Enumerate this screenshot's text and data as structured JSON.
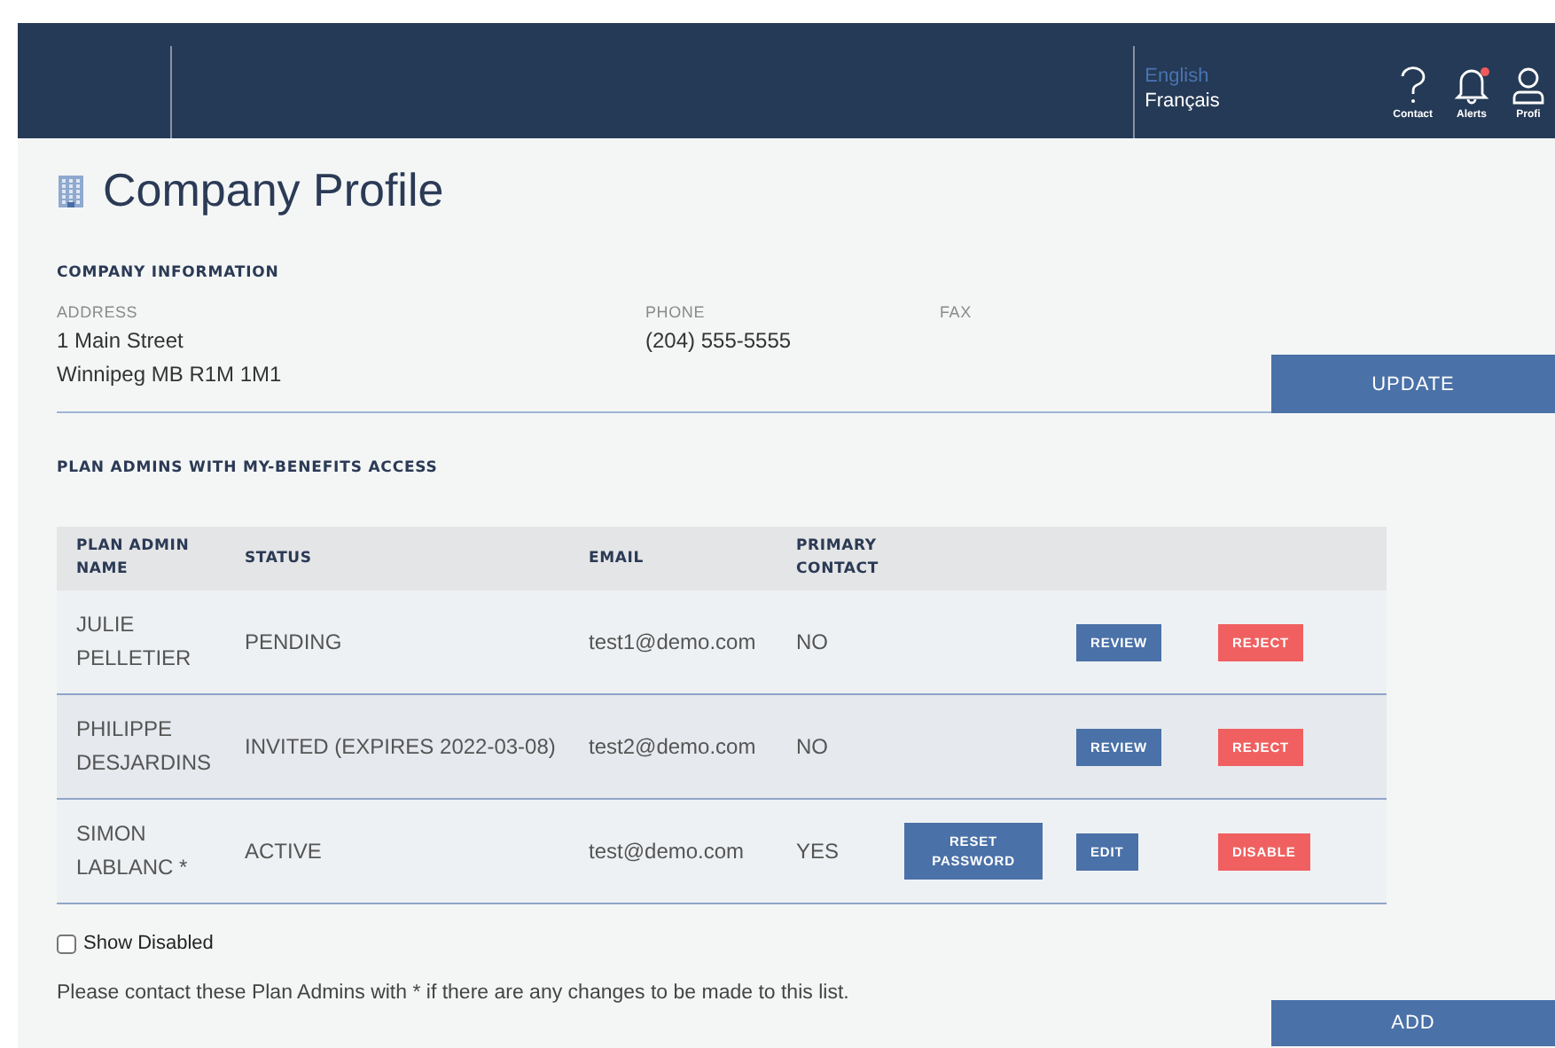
{
  "header": {
    "languages": [
      {
        "label": "English",
        "selected": true
      },
      {
        "label": "Français",
        "selected": false
      }
    ],
    "icons": [
      {
        "kind": "help",
        "label": "Contact",
        "badge": false
      },
      {
        "kind": "bell",
        "label": "Alerts",
        "badge": true
      },
      {
        "kind": "person",
        "label": "Profi",
        "badge": false
      }
    ]
  },
  "page": {
    "title": "Company Profile"
  },
  "company_information": {
    "heading": "COMPANY INFORMATION",
    "fields": [
      {
        "label": "ADDRESS",
        "lines": [
          "1 Main Street",
          "Winnipeg MB R1M 1M1"
        ]
      },
      {
        "label": "PHONE",
        "lines": [
          "(204) 555-5555"
        ]
      },
      {
        "label": "FAX"
      }
    ],
    "button": "UPDATE"
  },
  "plan_admins": {
    "heading": "PLAN ADMINS WITH MY-BENEFITS ACCESS",
    "columns": [
      "PLAN ADMIN NAME",
      "STATUS",
      "EMAIL",
      "PRIMARY CONTACT"
    ],
    "rows": [
      {
        "name": "JULIE PELLETIER",
        "status": "PENDING",
        "email": "test1@demo.com",
        "primary": "NO",
        "actions": [
          {
            "label": "REVIEW",
            "kind": "primary"
          },
          {
            "label": "REJECT",
            "kind": "danger"
          }
        ]
      },
      {
        "name": "PHILIPPE DESJARDINS",
        "status": "INVITED (EXPIRES 2022-03-08)",
        "email": "test2@demo.com",
        "primary": "NO",
        "actions": [
          {
            "label": "REVIEW",
            "kind": "primary"
          },
          {
            "label": "REJECT",
            "kind": "danger"
          }
        ]
      },
      {
        "name": "SIMON LABLANC *",
        "status": "ACTIVE",
        "email": "test@demo.com",
        "primary": "YES",
        "actions": [
          {
            "label": "RESET PASSWORD",
            "kind": "primary"
          },
          {
            "label": "EDIT",
            "kind": "primary"
          },
          {
            "label": "DISABLE",
            "kind": "danger"
          }
        ]
      }
    ],
    "show_disabled": {
      "label": "Show Disabled",
      "checked": false
    },
    "note": "Please contact these Plan Admins with * if there are any changes to be made to this list.",
    "button": "ADD"
  }
}
